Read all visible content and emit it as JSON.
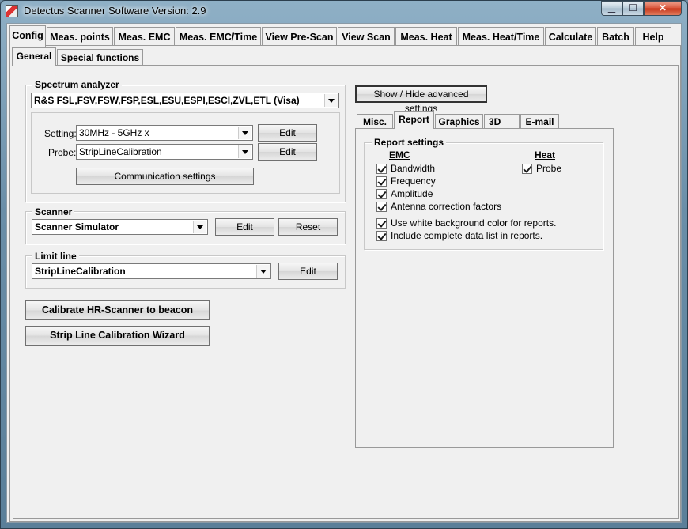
{
  "window": {
    "title": "Detectus Scanner Software Version: 2.9",
    "controls": {
      "minimize": "▁",
      "maximize": "☐",
      "close": "✕"
    }
  },
  "main_tabs": [
    "Config",
    "Meas. points",
    "Meas. EMC",
    "Meas. EMC/Time",
    "View Pre-Scan",
    "View Scan",
    "Meas. Heat",
    "Meas. Heat/Time",
    "Calculate",
    "Batch",
    "Help"
  ],
  "sub_tabs": [
    "General",
    "Special functions"
  ],
  "spectrum_analyzer": {
    "label": "Spectrum analyzer",
    "device": "R&S FSL,FSV,FSW,FSP,ESL,ESU,ESPI,ESCI,ZVL,ETL (Visa)",
    "setting_label": "Setting:",
    "setting_value": "30MHz - 5GHz x",
    "probe_label": "Probe:",
    "probe_value": "StripLineCalibration",
    "edit_label": "Edit",
    "comm_button": "Communication settings"
  },
  "scanner": {
    "label": "Scanner",
    "value": "Scanner Simulator",
    "edit_label": "Edit",
    "reset_label": "Reset"
  },
  "limit_line": {
    "label": "Limit line",
    "value": "StripLineCalibration",
    "edit_label": "Edit"
  },
  "actions": {
    "calibrate": "Calibrate HR-Scanner to beacon",
    "wizard": "Strip Line Calibration Wizard"
  },
  "advanced": {
    "toggle_button": "Show / Hide advanced settings",
    "tabs": [
      "Misc.",
      "Report",
      "Graphics",
      "3D",
      "E-mail"
    ],
    "report_settings": {
      "label": "Report settings",
      "emc_heading": "EMC",
      "heat_heading": "Heat",
      "emc_items": [
        {
          "label": "Bandwidth",
          "checked": true
        },
        {
          "label": "Frequency",
          "checked": true
        },
        {
          "label": "Amplitude",
          "checked": true
        },
        {
          "label": "Antenna correction factors",
          "checked": true
        }
      ],
      "heat_items": [
        {
          "label": "Probe",
          "checked": true
        }
      ],
      "general_items": [
        {
          "label": "Use white background color for reports.",
          "checked": true
        },
        {
          "label": "Include complete data list in reports.",
          "checked": true
        }
      ]
    }
  }
}
